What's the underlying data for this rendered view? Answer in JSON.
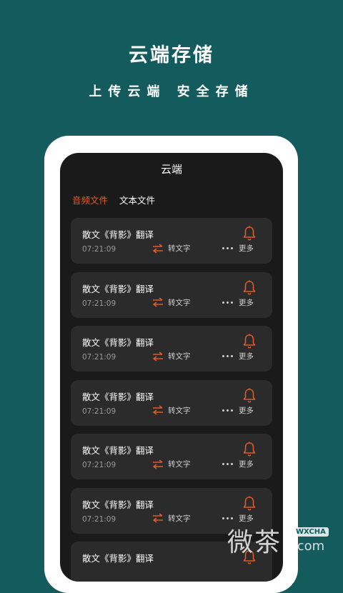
{
  "headline": "云端存储",
  "subline": "上传云端 安全存储",
  "screen": {
    "title": "云端",
    "tabs": [
      {
        "label": "音频文件",
        "active": true
      },
      {
        "label": "文本文件",
        "active": false
      }
    ],
    "items": [
      {
        "title": "散文《背影》翻译",
        "time": "07:21:09",
        "convert_label": "转文字",
        "more_label": "更多"
      },
      {
        "title": "散文《背影》翻译",
        "time": "07:21:09",
        "convert_label": "转文字",
        "more_label": "更多"
      },
      {
        "title": "散文《背影》翻译",
        "time": "07:21:09",
        "convert_label": "转文字",
        "more_label": "更多"
      },
      {
        "title": "散文《背影》翻译",
        "time": "07:21:09",
        "convert_label": "转文字",
        "more_label": "更多"
      },
      {
        "title": "散文《背影》翻译",
        "time": "07:21:09",
        "convert_label": "转文字",
        "more_label": "更多"
      },
      {
        "title": "散文《背影》翻译",
        "time": "07:21:09",
        "convert_label": "转文字",
        "more_label": "更多"
      },
      {
        "title": "散文《背影》翻译",
        "time": "",
        "convert_label": "",
        "more_label": ""
      }
    ]
  },
  "watermark": {
    "text": "微茶",
    "badge": "WXCHA",
    "suffix": ".com"
  },
  "colors": {
    "background": "#135b5c",
    "accent": "#e05a2b",
    "card": "#2b2b2b",
    "screen": "#1a1a1a"
  },
  "icons": {
    "convert": "swap-arrows-icon",
    "more": "more-dots-icon",
    "bell": "bell-icon"
  }
}
